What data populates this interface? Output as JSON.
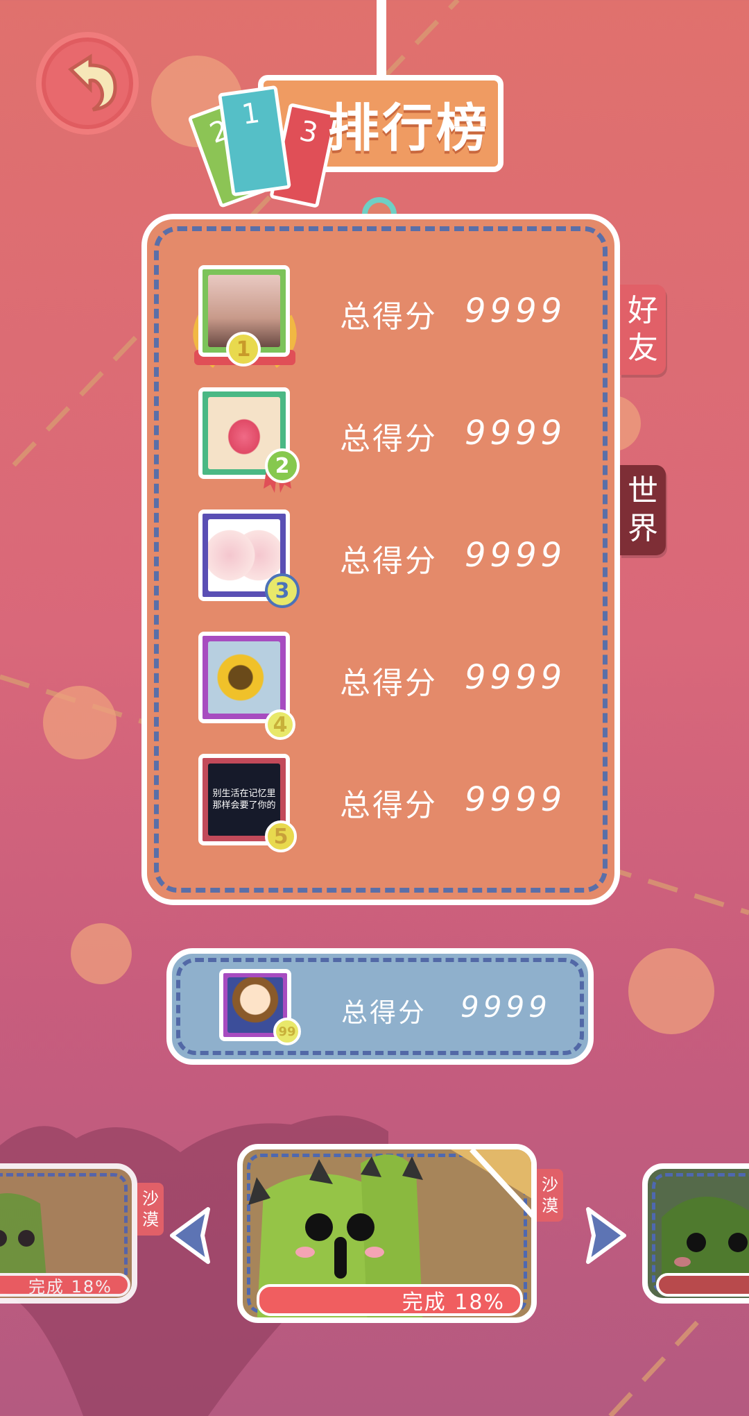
{
  "title": {
    "text": "排行榜",
    "card_numbers": [
      "2",
      "1",
      "3"
    ]
  },
  "tabs": [
    {
      "label_line1": "好",
      "label_line2": "友",
      "color": "#e16068"
    },
    {
      "label_line1": "世",
      "label_line2": "界",
      "color": "#7e2e36"
    }
  ],
  "leaderboard": {
    "rows": [
      {
        "rank": "1",
        "label": "总得分",
        "score": "9999",
        "frame_color": "#7cc35a",
        "badge_color": "#e8d94e"
      },
      {
        "rank": "2",
        "label": "总得分",
        "score": "9999",
        "frame_color": "#4ab884",
        "badge_color": "#86c84e"
      },
      {
        "rank": "3",
        "label": "总得分",
        "score": "9999",
        "frame_color": "#5a4fb4",
        "badge_color": "#4c72b8"
      },
      {
        "rank": "4",
        "label": "总得分",
        "score": "9999",
        "frame_color": "#a74cc0",
        "badge_color": "#e8e86a"
      },
      {
        "rank": "5",
        "label": "总得分",
        "score": "9999",
        "frame_color": "#c24a5a",
        "badge_color": "#e8d94e"
      }
    ],
    "row5_image_text_line1": "别生活在记忆里",
    "row5_image_text_line2": "那样会要了你的"
  },
  "self": {
    "rank": "99",
    "label": "总得分",
    "score": "9999"
  },
  "levels": {
    "tag_line1": "沙",
    "tag_line2": "漠",
    "progress_center": "完成 18%",
    "progress_left": "完成 18%"
  },
  "colors": {
    "accent": "#ef9b62",
    "panel": "#e48a6a",
    "self_panel": "#8fb0cc",
    "dash": "#5a6fa8"
  }
}
